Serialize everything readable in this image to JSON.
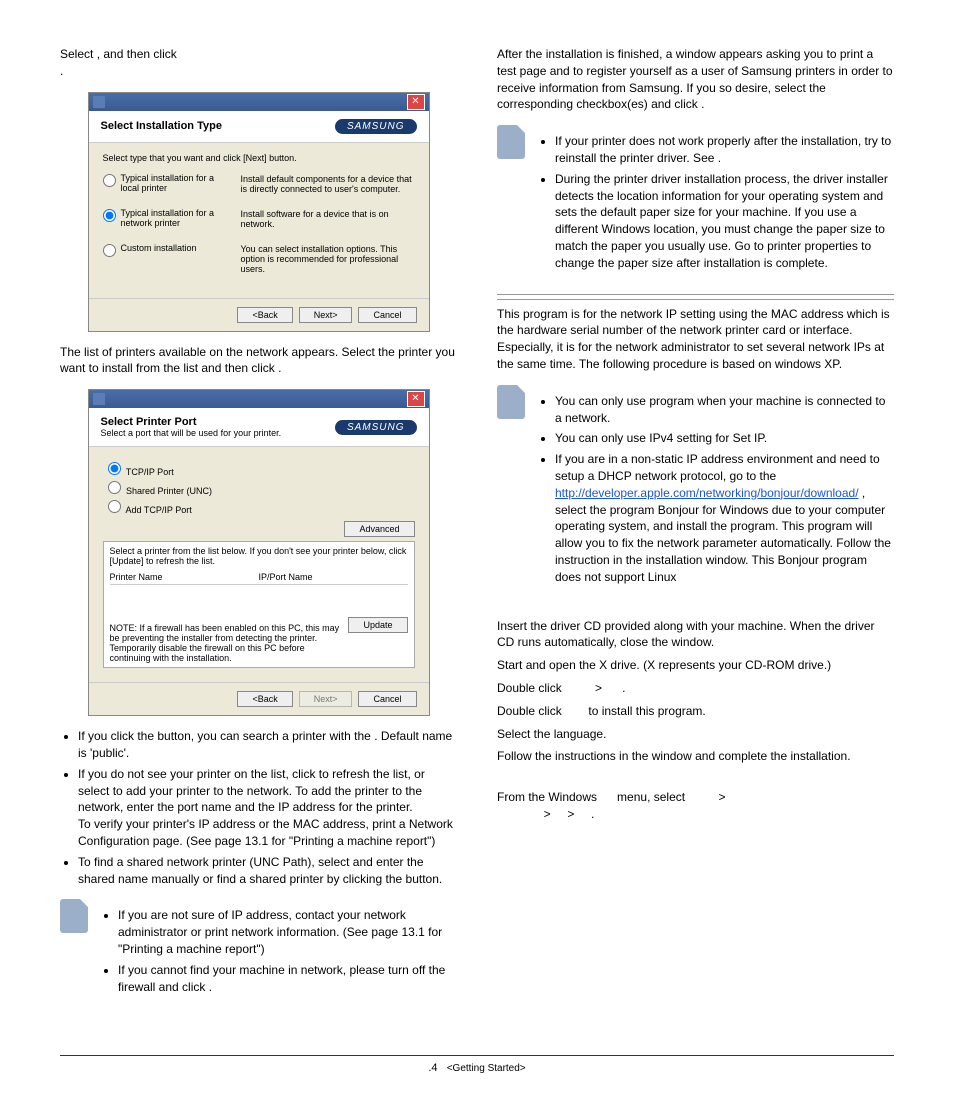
{
  "left": {
    "step5_select": "Select",
    "step5_then": ", and then click",
    "step5_end": ".",
    "dialog1": {
      "title": "Select Installation Type",
      "logo": "SAMSUNG",
      "instr": "Select type that you want and click [Next] button.",
      "opt1_label": "Typical installation for a local printer",
      "opt1_desc": "Install default components for a device that is directly connected to user's computer.",
      "opt2_label": "Typical installation for a network printer",
      "opt2_desc": "Install software for a device that is on network.",
      "opt3_label": "Custom installation",
      "opt3_desc": "You can select installation options. This option is recommended for professional users.",
      "back": "<Back",
      "next": "Next>",
      "cancel": "Cancel"
    },
    "step6": "The list of printers available on the network appears. Select the printer you want to install from the list and then click",
    "step6_end": ".",
    "dialog2": {
      "title": "Select Printer Port",
      "sub": "Select a port that will be used for your printer.",
      "logo": "SAMSUNG",
      "r1": "TCP/IP Port",
      "r2": "Shared Printer (UNC)",
      "r3": "Add TCP/IP Port",
      "adv": "Advanced",
      "instr": "Select a printer from the list below. If you don't see your printer below, click [Update] to refresh the list.",
      "col1": "Printer Name",
      "col2": "IP/Port Name",
      "note": "NOTE: If a firewall has been enabled on this PC, this may be preventing the installer from detecting the printer. Temporarily disable the firewall on this PC before continuing with the installation.",
      "update": "Update",
      "back": "<Back",
      "next": "Next>",
      "cancel": "Cancel"
    },
    "b1a": "If you click the",
    "b1b": "button, you can search a printer with the",
    "b1c": ". Default name is 'public'.",
    "b2a": "If you do not see your printer on the list, click",
    "b2b": "to refresh the list, or select",
    "b2c": "to add your printer to the network. To add the printer to the network, enter the port name and the IP address for the printer.",
    "b2d": "To verify your printer's IP address or the MAC address, print a Network Configuration page. (See  page 13.1 for \"Printing a machine report\")",
    "b3a": "To find a shared network printer (UNC Path), select",
    "b3b": "and enter the shared name manually or find a shared printer by clicking the",
    "b3c": "button.",
    "note2_b1": "If you are not sure of IP address, contact your network administrator or print network information. (See  page 13.1 for \"Printing a machine report\")",
    "note2_b2a": "If you cannot find your machine in network, please turn off the firewall and click",
    "note2_b2b": "."
  },
  "right": {
    "step7": "After the installation is finished, a window appears asking you to print a test page and to register yourself as a user of Samsung printers in order to receive information from Samsung. If you so desire, select the corresponding checkbox(es) and click",
    "step7_end": ".",
    "note1_b1a": "If your printer does not work properly after the installation, try to reinstall the printer driver. See",
    "note1_b1b": ".",
    "note1_b2": "During the printer driver installation process, the driver installer detects the location information for your operating system and sets the default paper size for your machine. If you use a different Windows location, you must change the paper size to match the paper you usually use. Go to printer properties to change the paper size after installation is complete.",
    "setip_para": "This program is for the network IP setting using the MAC address which is the hardware serial number of the network printer card or interface. Especially, it is for the network administrator to set several network IPs at the same time. The following procedure is based on windows XP.",
    "note2_b1a": "You can only use",
    "note2_b1b": "program when your machine is connected to a network.",
    "note2_b2": "You can only use IPv4 setting for Set IP.",
    "note2_b3a": "If you are in a non-static IP address environment and need to setup a DHCP network protocol, go to the",
    "link": "http://developer.apple.com/networking/bonjour/download/",
    "note2_b3b": ", select the program Bonjour for Windows due to your computer operating system, and install the program. This program will allow you to fix the network parameter automatically. Follow the instruction in the installation window. This Bonjour program does not support Linux",
    "s1a": "Insert the driver CD provided along with your machine. When the driver CD runs automatically, close the window.",
    "s2a": "Start",
    "s2b": "and open the X drive. (X represents your CD-ROM drive.)",
    "s3a": "Double click",
    "s3b": ">",
    "s3c": ".",
    "s4a": "Double click",
    "s4b": "to install this program.",
    "s5": "Select the language.",
    "s6": "Follow the instructions in the window and complete the installation.",
    "s1_b": "From the Windows",
    "s1_c": "menu, select",
    "s1_d": ">",
    "s1_e": ">",
    "s1_f": ">",
    "s1_g": "."
  },
  "footer": {
    "page": ".4",
    "section": "<Getting Started>"
  }
}
